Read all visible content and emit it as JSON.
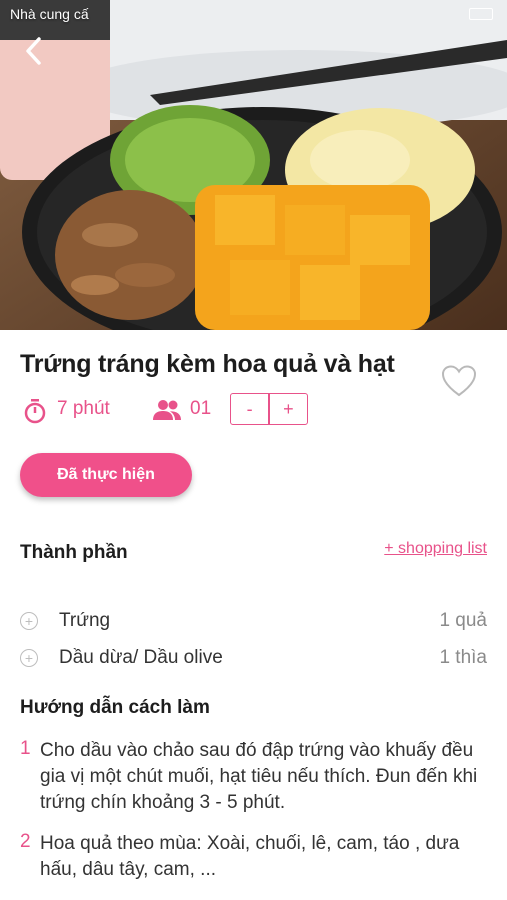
{
  "status": {
    "carrier": "Nhà cung cấ"
  },
  "recipe": {
    "title": "Trứng tráng kèm hoa quả và hạt",
    "time": "7 phút",
    "servings": "01",
    "stepper_minus": "-",
    "stepper_plus": "+",
    "done_label": "Đã thực hiện"
  },
  "ingredients": {
    "section_title": "Thành phần",
    "shopping_link": "+ shopping list",
    "items": [
      {
        "name": "Trứng",
        "qty": "1 quả"
      },
      {
        "name": "Dầu dừa/ Dầu olive",
        "qty": "1 thìa"
      }
    ]
  },
  "instructions": {
    "section_title": "Hướng dẫn cách làm",
    "steps": [
      {
        "num": "1",
        "text": "Cho dầu vào chảo sau đó đập trứng vào khuấy đều gia vị một chút muối, hạt tiêu nếu thích. Đun đến khi trứng chín khoảng 3 - 5 phút."
      },
      {
        "num": "2",
        "text": "Hoa quả theo mùa: Xoài, chuối, lê, cam, táo , dưa hấu, dâu tây, cam, ..."
      }
    ]
  },
  "colors": {
    "accent": "#e8528a",
    "button": "#f0508a"
  },
  "icons": [
    "back-arrow-icon",
    "heart-icon",
    "timer-icon",
    "people-icon",
    "add-circle-icon"
  ]
}
